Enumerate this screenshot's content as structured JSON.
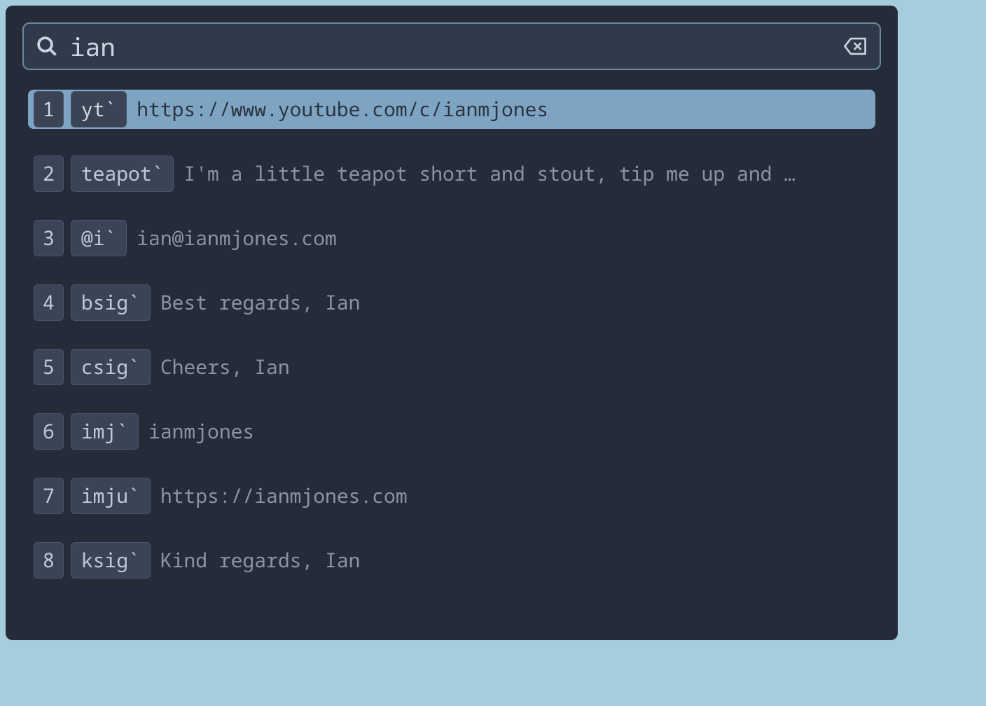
{
  "search": {
    "value": "ian"
  },
  "results": [
    {
      "num": "1",
      "trigger": "yt`",
      "expansion": "https://www.youtube.com/c/ianmjones",
      "selected": true
    },
    {
      "num": "2",
      "trigger": "teapot`",
      "expansion": "I'm a little teapot short and stout, tip me up and …",
      "selected": false
    },
    {
      "num": "3",
      "trigger": "@i`",
      "expansion": "ian@ianmjones.com",
      "selected": false
    },
    {
      "num": "4",
      "trigger": "bsig`",
      "expansion": "Best regards, Ian",
      "selected": false
    },
    {
      "num": "5",
      "trigger": "csig`",
      "expansion": "Cheers, Ian",
      "selected": false
    },
    {
      "num": "6",
      "trigger": "imj`",
      "expansion": "ianmjones",
      "selected": false
    },
    {
      "num": "7",
      "trigger": "imju`",
      "expansion": "https://ianmjones.com",
      "selected": false
    },
    {
      "num": "8",
      "trigger": "ksig`",
      "expansion": "Kind regards, Ian",
      "selected": false
    }
  ]
}
